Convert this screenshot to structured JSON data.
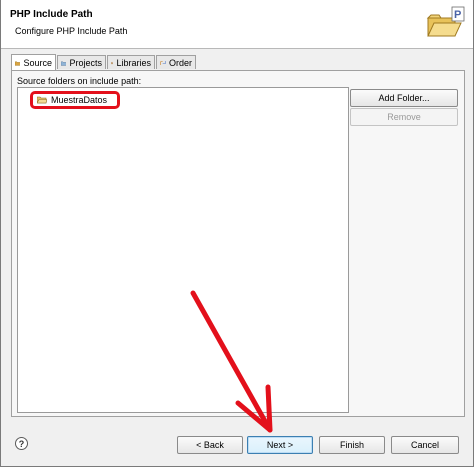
{
  "dialog": {
    "title": "PHP Include Path",
    "subtitle": "Configure PHP Include Path",
    "header_icon": "folder-php-icon"
  },
  "tabs": [
    {
      "label": "Source",
      "icon": "source-icon",
      "active": true
    },
    {
      "label": "Projects",
      "icon": "projects-icon",
      "active": false
    },
    {
      "label": "Libraries",
      "icon": "libraries-icon",
      "active": false
    },
    {
      "label": "Order",
      "icon": "order-icon",
      "active": false
    }
  ],
  "source": {
    "label": "Source folders on include path:",
    "items": [
      {
        "label": "MuestraDatos",
        "icon": "folder-icon",
        "highlighted": true
      }
    ],
    "add_folder_label": "Add Folder...",
    "remove_label": "Remove"
  },
  "footer": {
    "back_label": "< Back",
    "next_label": "Next >",
    "finish_label": "Finish",
    "cancel_label": "Cancel"
  },
  "colors": {
    "annotation_red": "#e3101b"
  }
}
